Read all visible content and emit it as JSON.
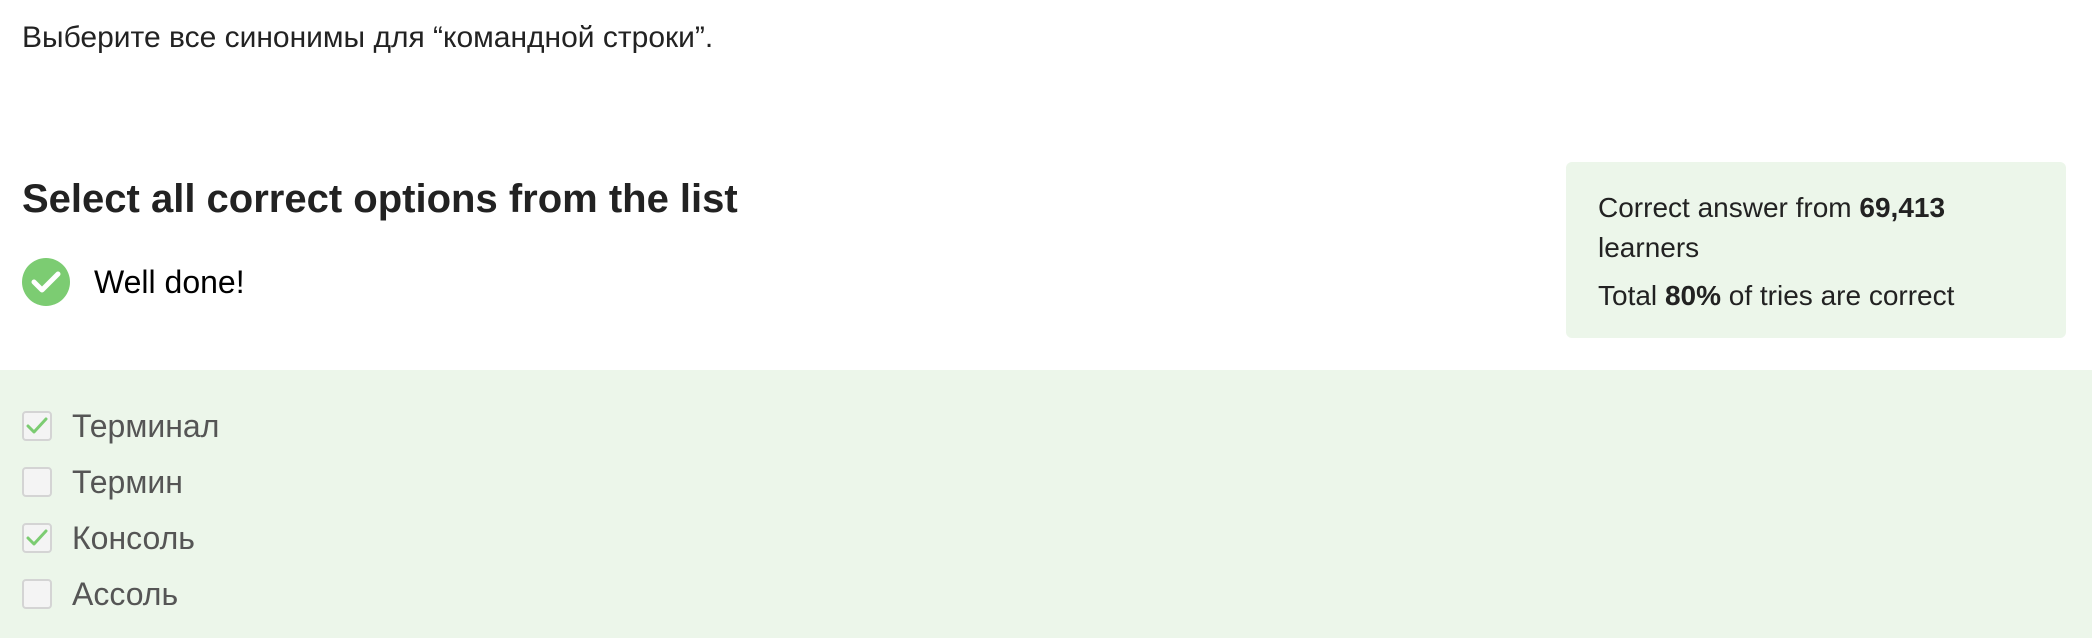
{
  "question": {
    "text": "Выберите все синонимы для “командной строки”."
  },
  "section": {
    "title": "Select all correct options from the list"
  },
  "result": {
    "text": "Well done!",
    "icon": "checkmark-circle-icon",
    "color": "#7ccc72"
  },
  "stats": {
    "prefix": "Correct answer from ",
    "learners_count": "69,413",
    "suffix": " learners",
    "total_prefix": "Total ",
    "percent": "80%",
    "total_suffix": " of tries are correct"
  },
  "options": [
    {
      "label": "Терминал",
      "checked": true
    },
    {
      "label": "Термин",
      "checked": false
    },
    {
      "label": "Консоль",
      "checked": true
    },
    {
      "label": "Ассоль",
      "checked": false
    }
  ],
  "colors": {
    "panel_bg": "#ecf6ea",
    "check_green": "#7ccc72"
  }
}
